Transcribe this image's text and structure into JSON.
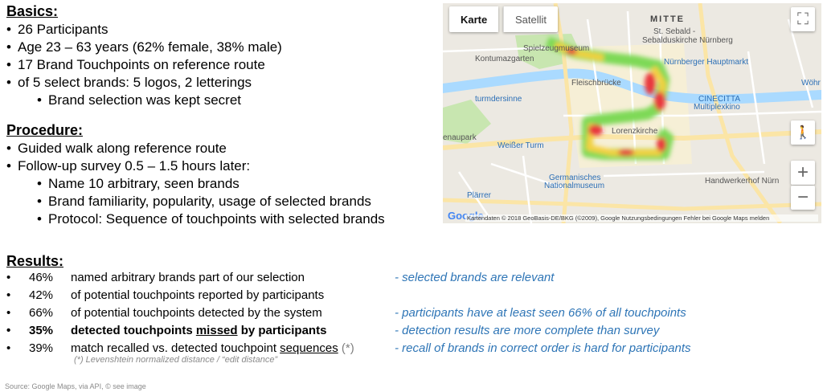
{
  "basics": {
    "heading": "Basics:",
    "items": [
      "26 Participants",
      "Age 23 – 63 years (62% female, 38% male)",
      "17 Brand Touchpoints on reference route",
      "of 5 select brands: 5 logos, 2 letterings"
    ],
    "sub_items": [
      "Brand selection was kept secret"
    ]
  },
  "procedure": {
    "heading": "Procedure:",
    "items": [
      "Guided walk along reference route",
      "Follow-up survey 0.5 – 1.5 hours later:"
    ],
    "sub_items": [
      "Name 10 arbitrary, seen brands",
      "Brand familiarity, popularity, usage of selected brands",
      "Protocol: Sequence of touchpoints with selected brands"
    ]
  },
  "results": {
    "heading": "Results:",
    "rows": [
      {
        "bullet": "•",
        "pct": "46%",
        "desc": "named arbitrary brands part of our selection",
        "comment": "- selected brands are relevant"
      },
      {
        "bullet": "•",
        "pct": "42%",
        "desc": "of potential touchpoints reported by participants",
        "comment": ""
      },
      {
        "bullet": "•",
        "pct": "66%",
        "desc": "of potential touchpoints detected by the system",
        "comment": "- participants have at least seen 66% of all touchpoints"
      },
      {
        "bullet": "•",
        "pct": "35%",
        "desc_pre": "detected touchpoints ",
        "desc_u": "missed",
        "desc_post": " by participants",
        "comment": "- detection results are more complete than survey"
      },
      {
        "bullet": "•",
        "pct": "39%",
        "desc_pre": "match recalled vs. detected touchpoint ",
        "desc_u": "sequences",
        "desc_ast": " (*)",
        "comment": "- recall of brands in correct order is hard for participants"
      }
    ],
    "footnote": "(*) Levenshtein normalized distance / “edit distance”"
  },
  "source": "Source: Google Maps, via API, © see image",
  "map": {
    "tabs": [
      "Karte",
      "Satellit"
    ],
    "labels": {
      "mitte": "MITTE",
      "st_sebald": "St. Sebald -",
      "sebaldus": "Sebalduskirche Nürnberg",
      "spielzeug": "Spielzeugmuseum",
      "kontumaz": "Kontumazgarten",
      "hbf": "Nürnberger Hauptmarkt",
      "fleisch": "Fleischbrücke",
      "turm": "turmdersinne",
      "lorenz": "Lorenzkirche",
      "cinecitta": "CINECITTA",
      "multiplex": "Multiplexkino",
      "weisser": "Weißer Turm",
      "enaupark": "enaupark",
      "gnm1": "Germanisches",
      "gnm2": "Nationalmuseum",
      "handwerk": "Handwerkerhof Nürn",
      "plaerrer": "Plärrer",
      "woehr": "Wöhr"
    },
    "google": "Google",
    "attribution": "Kartendaten © 2018 GeoBasis-DE/BKG (©2009), Google   Nutzungsbedingungen   Fehler bei Google Maps melden",
    "colors": {
      "heat_hot": "#e8383d",
      "heat_warm": "#f4d03f",
      "heat_cool": "#7ed957",
      "river": "#aadaff",
      "park": "#c8e6b0",
      "road": "#ffffff",
      "arterial": "#fbe5a6"
    }
  }
}
